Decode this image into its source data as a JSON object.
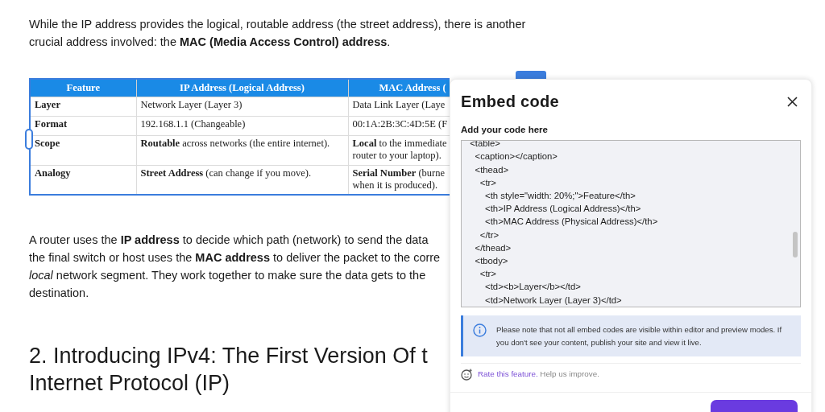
{
  "article": {
    "intro": "While the IP address provides the logical, routable address (the street address), there is another\ncrucial address involved: the **MAC (Media Access Control) address**.",
    "table": {
      "columns": [
        "Feature",
        "IP Address (Logical Address)",
        "MAC Address ("
      ],
      "rows": [
        [
          "Layer",
          "Network Layer (Layer 3)",
          "Data Link Layer (Laye"
        ],
        [
          "Format",
          "192.168.1.1 (Changeable)",
          "00:1A:2B:3C:4D:5E (F"
        ],
        [
          "Scope",
          "**Routable** across networks (the entire internet).",
          "**Local** to the immediate\nrouter to your laptop)."
        ],
        [
          "Analogy",
          "**Street Address** (can change if you move).",
          "**Serial Number** (burne\nwhen it is produced)."
        ]
      ]
    },
    "paragraph": "A router uses the **IP address** to decide which path (network) to send the data\nthe final switch or host uses the **MAC address** to deliver the packet to the corre\n*local* network segment. They work together to make sure the data gets to the\ndestination.",
    "heading": "2. Introducing IPv4: The First Version Of t\nInternet Protocol (IP)"
  },
  "dialog": {
    "title": "Embed code",
    "field_label": "Add your code here",
    "code_lines": [
      "  <table>",
      "    <caption></caption>",
      "    <thead>",
      "      <tr>",
      "        <th style=\"width: 20%;\">Feature</th>",
      "        <th>IP Address (Logical Address)</th>",
      "        <th>MAC Address (Physical Address)</th>",
      "      </tr>",
      "    </thead>",
      "    <tbody>",
      "      <tr>",
      "        <td><b>Layer</b></td>",
      "        <td>Network Layer (Layer 3)</td>"
    ],
    "notice": "Please note that not all embed codes are visible within editor and preview modes. If you don't see your content, publish your site and view it live.",
    "rate_link": "Rate this feature.",
    "rate_text": "Help us improve."
  }
}
